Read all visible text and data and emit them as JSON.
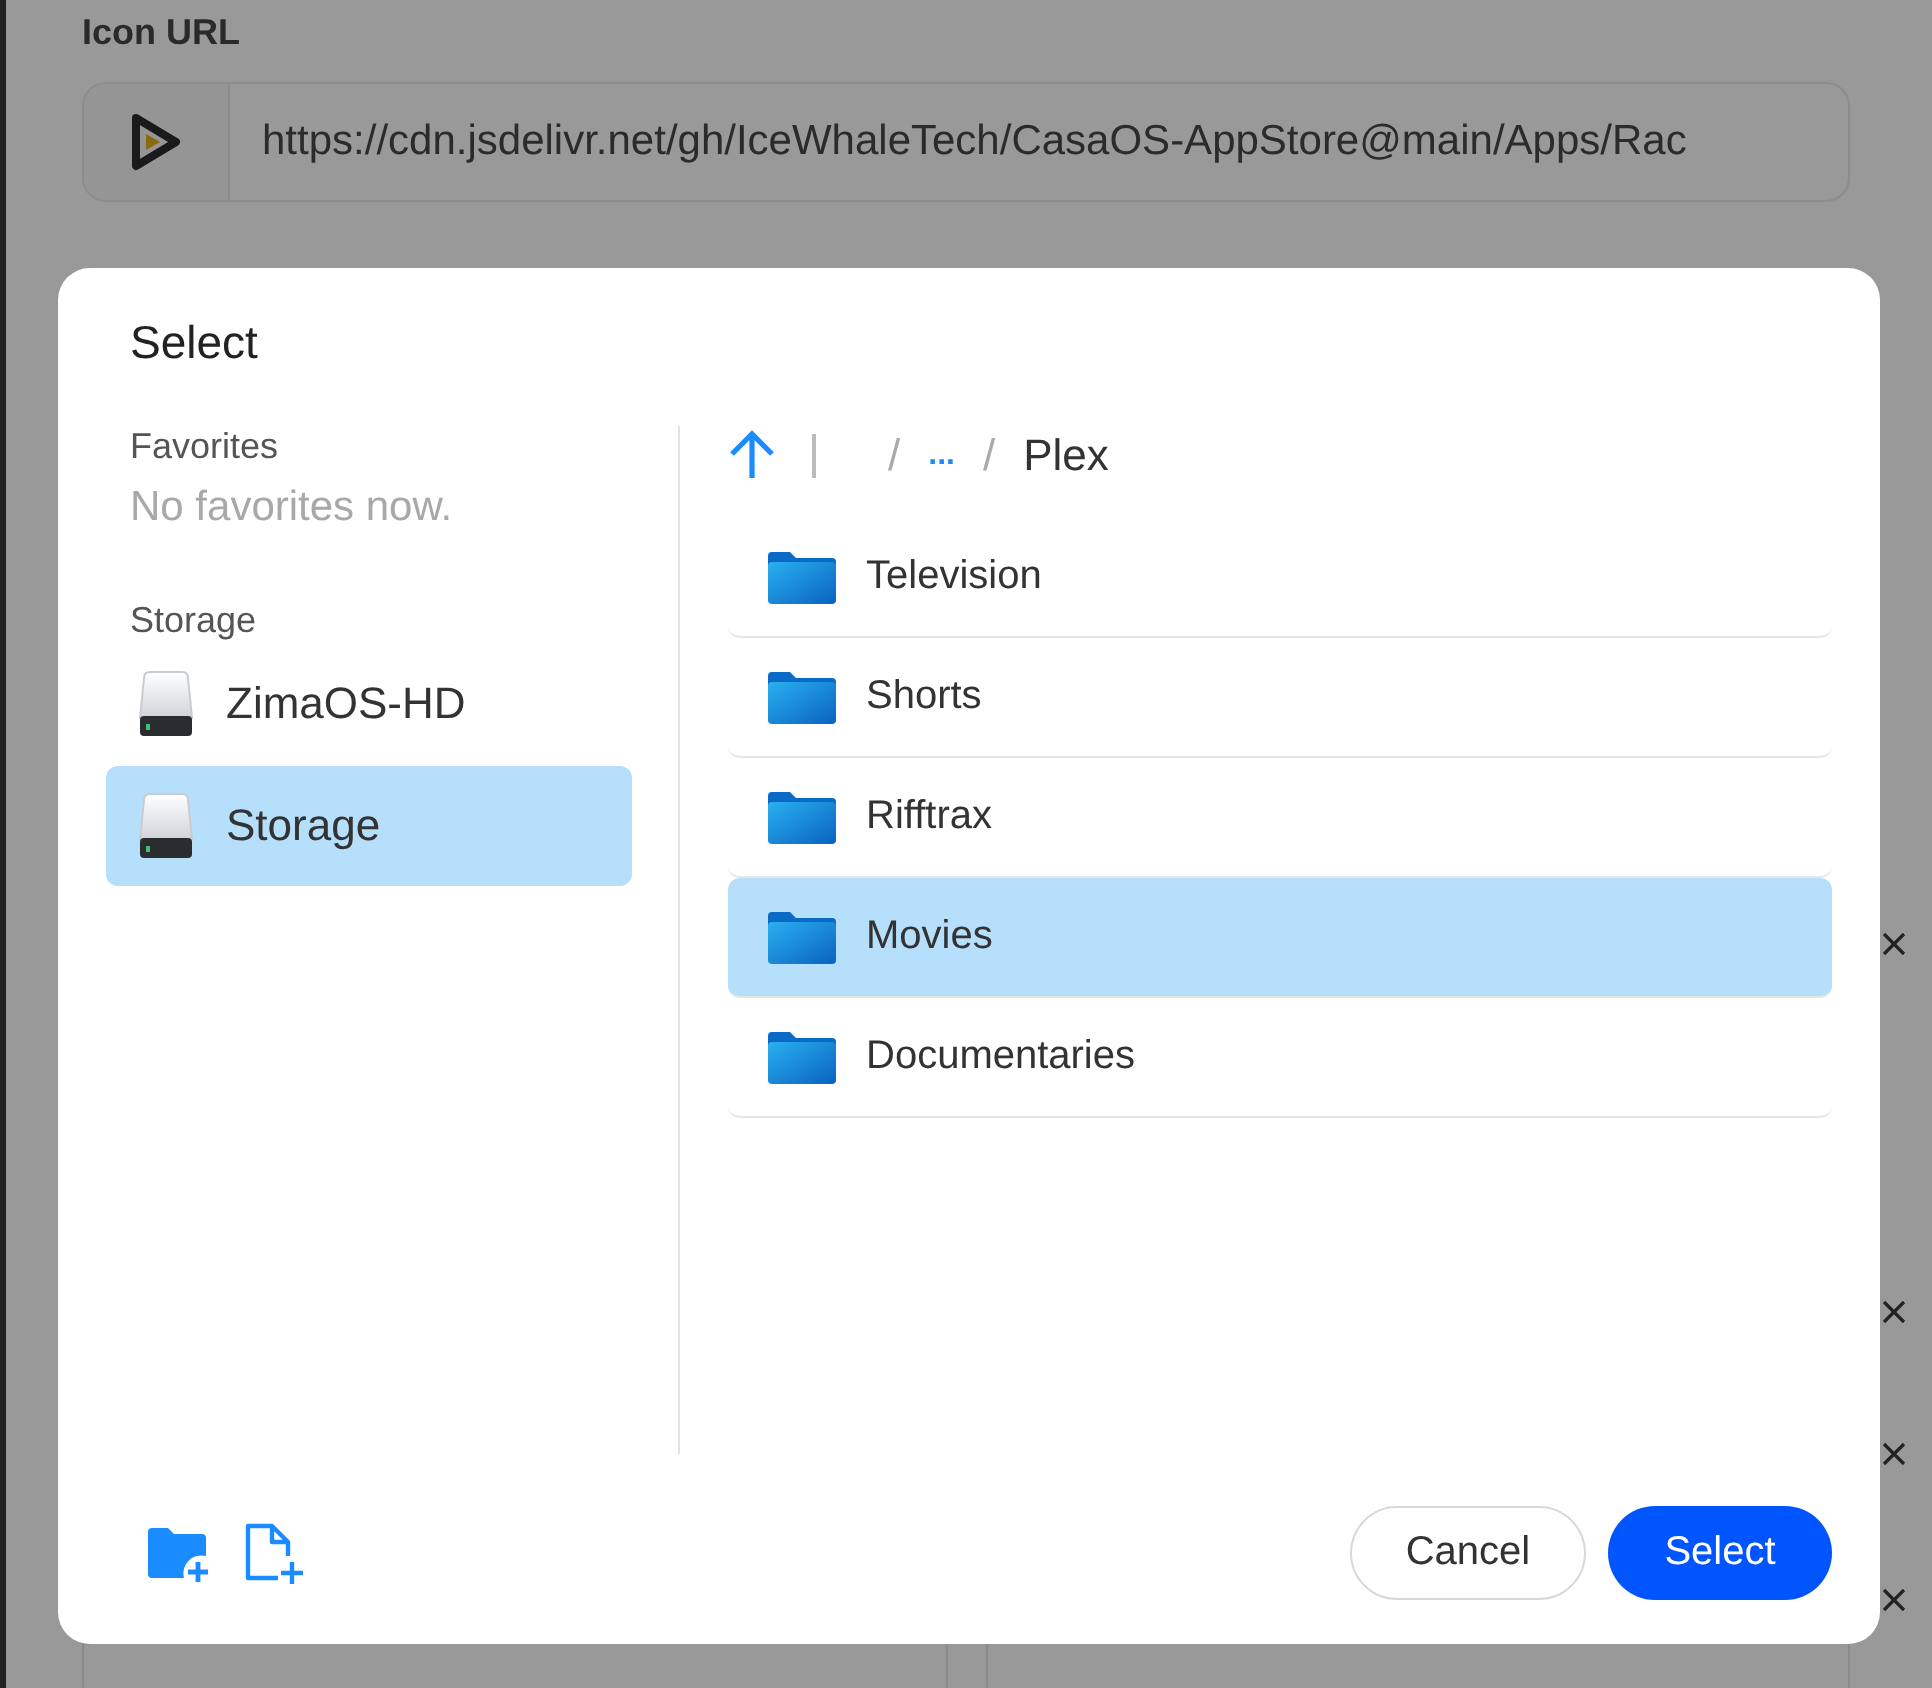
{
  "form": {
    "icon_url": {
      "label": "Icon URL",
      "value": "https://cdn.jsdelivr.net/gh/IceWhaleTech/CasaOS-AppStore@main/Apps/Rac"
    }
  },
  "dialog": {
    "title": "Select",
    "favorites": {
      "heading": "Favorites",
      "empty_text": "No favorites now."
    },
    "storage": {
      "heading": "Storage",
      "items": [
        {
          "name": "ZimaOS-HD",
          "selected": false
        },
        {
          "name": "Storage",
          "selected": true
        }
      ]
    },
    "breadcrumb": [
      {
        "label": "/",
        "kind": "separator"
      },
      {
        "label": "...",
        "kind": "link"
      },
      {
        "label": "/",
        "kind": "separator"
      },
      {
        "label": "Plex",
        "kind": "current"
      }
    ],
    "folders": [
      {
        "name": "Television",
        "selected": false
      },
      {
        "name": "Shorts",
        "selected": false
      },
      {
        "name": "Rifftrax",
        "selected": false
      },
      {
        "name": "Movies",
        "selected": true
      },
      {
        "name": "Documentaries",
        "selected": false
      }
    ],
    "buttons": {
      "cancel": "Cancel",
      "confirm": "Select"
    }
  }
}
